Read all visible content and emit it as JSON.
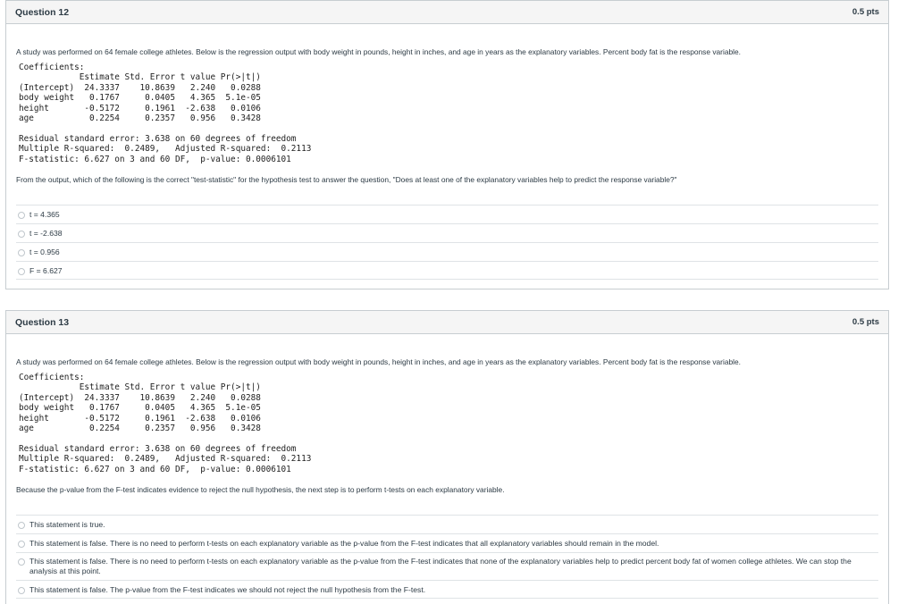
{
  "questions": [
    {
      "title": "Question 12",
      "points": "0.5 pts",
      "intro": "A study was performed on 64 female college athletes. Below is the regression output with body weight in pounds, height in inches, and age in years as the explanatory variables. Percent body fat is the response variable.",
      "output": "Coefficients:\n            Estimate Std. Error t value Pr(>|t|)\n(Intercept)  24.3337    10.8639   2.240   0.0288\nbody weight   0.1767     0.0405   4.365  5.1e-05\nheight       -0.5172     0.1961  -2.638   0.0106\nage           0.2254     0.2357   0.956   0.3428\n\nResidual standard error: 3.638 on 60 degrees of freedom\nMultiple R-squared:  0.2489,   Adjusted R-squared:  0.2113\nF-statistic: 6.627 on 3 and 60 DF,  p-value: 0.0006101",
      "question": "From the output, which of the following is the correct \"test-statistic\" for the hypothesis test to answer the question, \"Does at least one of the explanatory variables help to predict the response variable?\"",
      "answers": [
        "t = 4.365",
        "t = -2.638",
        "t = 0.956",
        "F = 6.627"
      ]
    },
    {
      "title": "Question 13",
      "points": "0.5 pts",
      "intro": "A study was performed on 64 female college athletes. Below is the regression output with body weight in pounds, height in inches, and age in years as the explanatory variables. Percent body fat is the response variable.",
      "output": "Coefficients:\n            Estimate Std. Error t value Pr(>|t|)\n(Intercept)  24.3337    10.8639   2.240   0.0288\nbody weight   0.1767     0.0405   4.365  5.1e-05\nheight       -0.5172     0.1961  -2.638   0.0106\nage           0.2254     0.2357   0.956   0.3428\n\nResidual standard error: 3.638 on 60 degrees of freedom\nMultiple R-squared:  0.2489,   Adjusted R-squared:  0.2113\nF-statistic: 6.627 on 3 and 60 DF,  p-value: 0.0006101",
      "question": "Because the p-value from the F-test indicates evidence to reject the null hypothesis, the next step is to perform t-tests on each explanatory variable.",
      "answers": [
        "This statement is true.",
        "This statement is false. There is no need to perform t-tests on each explanatory variable as the p-value from the F-test indicates that all explanatory variables should remain in the model.",
        "This statement is false. There is no need to perform t-tests on each explanatory variable as the p-value from the F-test indicates that none of the explanatory variables help to predict percent body fat of women college athletes. We can stop the analysis at this point.",
        "This statement is false. The p-value from the F-test indicates we should not reject the null hypothesis from the F-test."
      ]
    }
  ]
}
